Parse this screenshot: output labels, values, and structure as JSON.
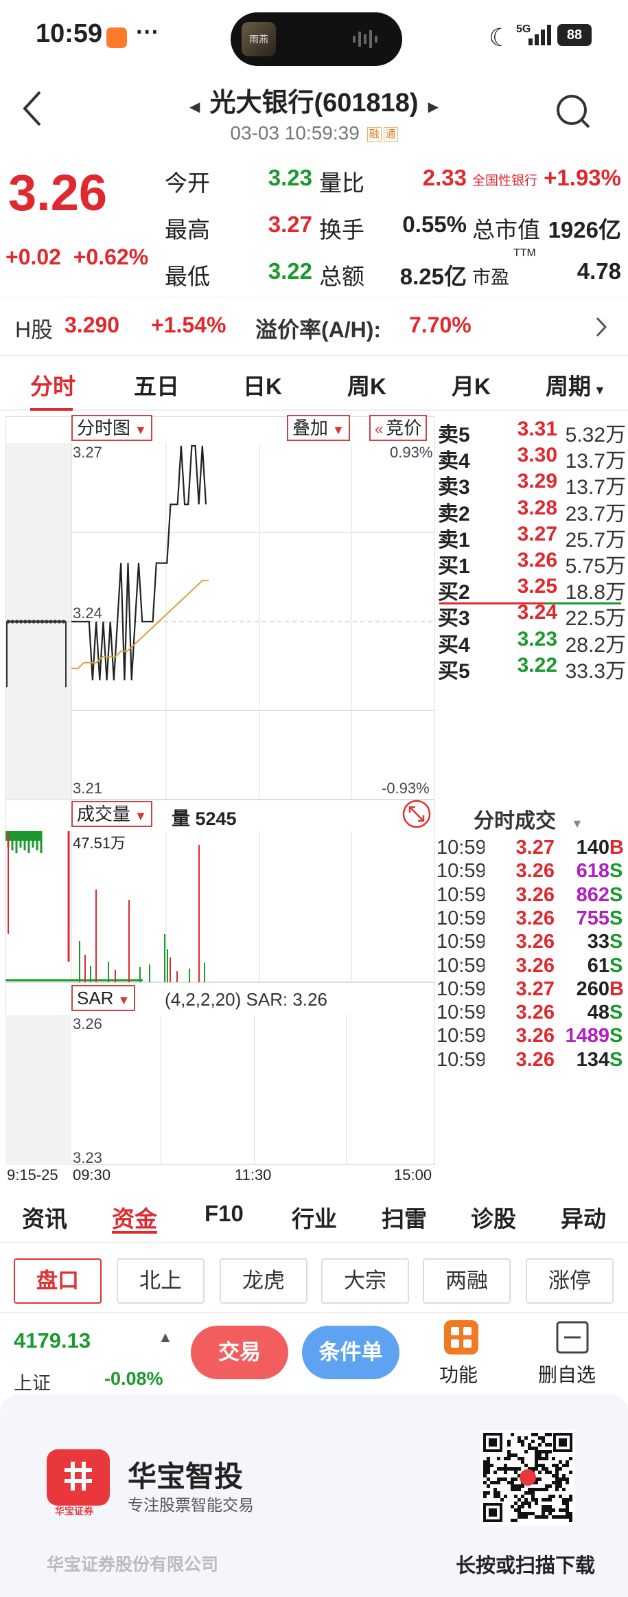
{
  "status_bar": {
    "time": "10:59",
    "dots": "···",
    "network": "5G",
    "battery": "88",
    "island_thumb": "雨燕"
  },
  "header": {
    "title": "光大银行(601818)",
    "datetime": "03-03 10:59:39",
    "tag_rong": "融",
    "tag_tong": "通"
  },
  "quote": {
    "price": "3.26",
    "change": "+0.02",
    "change_pct": "+0.62%",
    "open_label": "今开",
    "open": "3.23",
    "high_label": "最高",
    "high": "3.27",
    "low_label": "最低",
    "low": "3.22",
    "vol_ratio_label": "量比",
    "vol_ratio": "2.33",
    "turnover_label": "换手",
    "turnover": "0.55%",
    "amount_label": "总额",
    "amount": "8.25亿",
    "sector_label": "全国性银行",
    "sector_pct": "+1.93%",
    "mktcap_label": "总市值",
    "mktcap": "1926亿",
    "pe_label": "市盈",
    "pe_sup": "TTM",
    "pe": "4.78"
  },
  "hshare": {
    "label": "H股",
    "price": "3.290",
    "pct": "+1.54%",
    "premium_label": "溢价率(A/H):",
    "premium": "7.70%"
  },
  "tabs": [
    "分时",
    "五日",
    "日K",
    "周K",
    "月K",
    "周期"
  ],
  "chart": {
    "selector": "分时图",
    "overlay": "叠加",
    "auction": "竞价",
    "y_top": "3.27",
    "y_mid": "3.24",
    "y_bottom": "3.21",
    "pct_top": "0.93%",
    "pct_bottom": "-0.93%",
    "volume_selector": "成交量",
    "volume_label": "量 5245",
    "volume_max": "47.51万",
    "sar_selector": "SAR",
    "sar_label": "(4,2,2,20) SAR: 3.26",
    "sar_top": "3.26",
    "sar_bottom": "3.23",
    "time_start": "9:15-25",
    "time_open": "09:30",
    "time_mid": "11:30",
    "time_end": "15:00"
  },
  "chart_data": {
    "type": "line",
    "series": [
      {
        "values": [
          3.24,
          3.24,
          3.24,
          3.24,
          3.24,
          3.24,
          3.23,
          3.24,
          3.23,
          3.24,
          3.23,
          3.24,
          3.23,
          3.24,
          3.25,
          3.23,
          3.25,
          3.23,
          3.24,
          3.25,
          3.24,
          3.24,
          3.24,
          3.24,
          3.25,
          3.25,
          3.25,
          3.25,
          3.26,
          3.26,
          3.26,
          3.27,
          3.26,
          3.26,
          3.27,
          3.27,
          3.26,
          3.27,
          3.26
        ]
      },
      {
        "values": [
          3.232,
          3.232,
          3.233,
          3.233,
          3.233,
          3.234,
          3.234,
          3.234,
          3.235,
          3.235,
          3.236,
          3.237,
          3.238,
          3.239,
          3.24,
          3.241,
          3.242,
          3.243,
          3.244,
          3.245,
          3.246,
          3.247,
          3.247
        ]
      }
    ],
    "ylim": [
      3.21,
      3.27
    ]
  },
  "orderbook": {
    "asks": [
      {
        "label": "卖5",
        "price": "3.31",
        "vol": "5.32万"
      },
      {
        "label": "卖4",
        "price": "3.30",
        "vol": "13.7万"
      },
      {
        "label": "卖3",
        "price": "3.29",
        "vol": "13.7万"
      },
      {
        "label": "卖2",
        "price": "3.28",
        "vol": "23.7万"
      },
      {
        "label": "卖1",
        "price": "3.27",
        "vol": "25.7万"
      }
    ],
    "bids": [
      {
        "label": "买1",
        "price": "3.26",
        "vol": "5.75万"
      },
      {
        "label": "买2",
        "price": "3.25",
        "vol": "18.8万"
      },
      {
        "label": "买3",
        "price": "3.24",
        "vol": "22.5万"
      },
      {
        "label": "买4",
        "price": "3.23",
        "vol": "28.2万"
      },
      {
        "label": "买5",
        "price": "3.22",
        "vol": "33.3万"
      }
    ]
  },
  "trades": {
    "title": "分时成交",
    "rows": [
      {
        "time": "10:59",
        "price": "3.27",
        "vol": "140",
        "side": "B"
      },
      {
        "time": "10:59",
        "price": "3.26",
        "vol": "618",
        "side": "S"
      },
      {
        "time": "10:59",
        "price": "3.26",
        "vol": "862",
        "side": "S"
      },
      {
        "time": "10:59",
        "price": "3.26",
        "vol": "755",
        "side": "S"
      },
      {
        "time": "10:59",
        "price": "3.26",
        "vol": "33",
        "side": "S"
      },
      {
        "time": "10:59",
        "price": "3.26",
        "vol": "61",
        "side": "S"
      },
      {
        "time": "10:59",
        "price": "3.27",
        "vol": "260",
        "side": "B"
      },
      {
        "time": "10:59",
        "price": "3.26",
        "vol": "48",
        "side": "S"
      },
      {
        "time": "10:59",
        "price": "3.26",
        "vol": "1489",
        "side": "S"
      },
      {
        "time": "10:59",
        "price": "3.26",
        "vol": "134",
        "side": "S"
      }
    ]
  },
  "bottom_tabs": [
    "资讯",
    "资金",
    "F10",
    "行业",
    "扫雷",
    "诊股",
    "异动"
  ],
  "chips": [
    "盘口",
    "北上",
    "龙虎",
    "大宗",
    "两融",
    "涨停"
  ],
  "index": {
    "value": "4179.13",
    "name": "上证",
    "pct": "-0.08%"
  },
  "actions": {
    "trade": "交易",
    "condition": "条件单",
    "func": "功能",
    "del": "删自选"
  },
  "footer": {
    "brand": "华宝智投",
    "slogan": "专注股票智能交易",
    "logo_sub": "华宝证券",
    "company": "华宝证券股份有限公司",
    "qr_caption": "长按或扫描下载"
  },
  "colors": {
    "up": "#e0292e",
    "down": "#1a9a2c",
    "price_line": "#222222",
    "avg_line": "#d9a23a"
  }
}
